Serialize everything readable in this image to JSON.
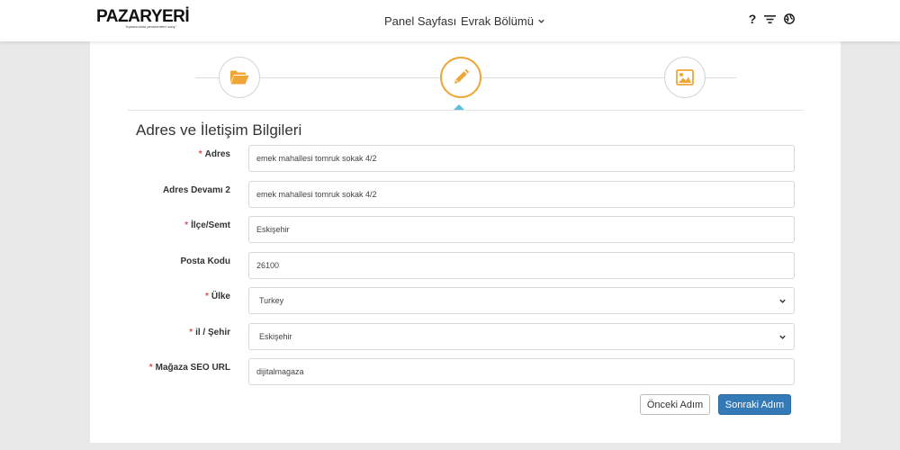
{
  "header": {
    "logo_text": "PAZARYERİ",
    "logo_tagline": "\"toptancılarla perakendeci satış\"",
    "nav": {
      "home": "Panel Sayfası",
      "documents": "Evrak Bölümü"
    },
    "help_symbol": "?"
  },
  "steps": [
    {
      "icon": "folder-open-icon",
      "state": "done"
    },
    {
      "icon": "pencil-icon",
      "state": "active"
    },
    {
      "icon": "image-icon",
      "state": "pending"
    }
  ],
  "form": {
    "title": "Adres ve İletişim Bilgileri",
    "required_marker": "*",
    "fields": {
      "address": {
        "label": "Adres",
        "value": "emek mahallesi tomruk sokak 4/2",
        "required": true
      },
      "address2": {
        "label": "Adres Devamı 2",
        "value": "emek mahallesi tomruk sokak 4/2",
        "required": false
      },
      "district": {
        "label": "İlçe/Semt",
        "value": "Eskişehir",
        "required": true
      },
      "postal_code": {
        "label": "Posta Kodu",
        "value": "26100",
        "required": false
      },
      "country": {
        "label": "Ülke",
        "value": "Turkey",
        "required": true
      },
      "city": {
        "label": "il / Şehir",
        "value": "Eskişehir",
        "required": true
      },
      "seo_url": {
        "label": "Mağaza SEO URL",
        "value": "dijitalmagaza",
        "required": true
      }
    },
    "buttons": {
      "prev": "Önceki Adım",
      "next": "Sonraki Adım"
    }
  },
  "colors": {
    "accent_orange": "#f0a637",
    "primary_blue": "#337ab7",
    "required_red": "#d9534f",
    "pointer_cyan": "#5bc0de"
  }
}
